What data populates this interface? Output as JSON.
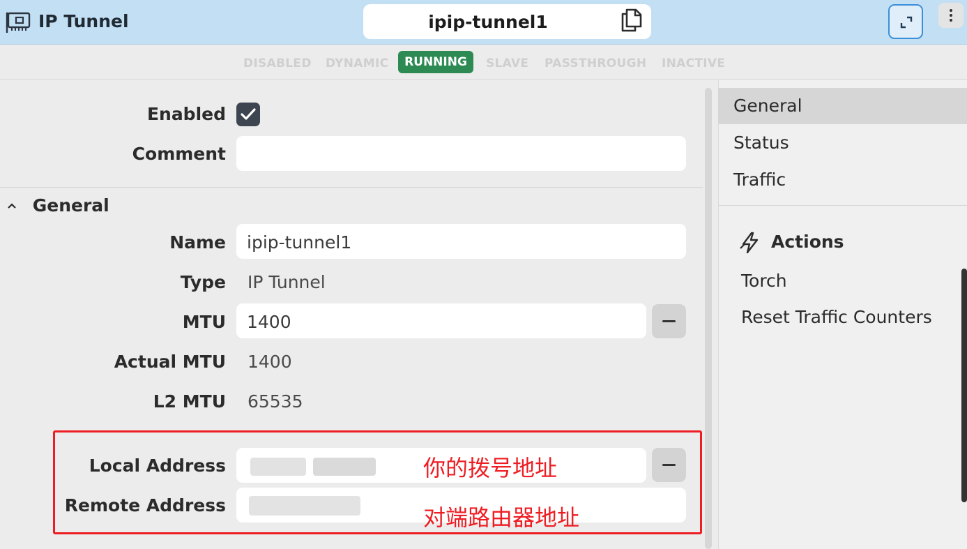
{
  "header": {
    "app_title": "IP Tunnel",
    "interface_name": "ipip-tunnel1",
    "icons": {
      "app": "network-card-icon",
      "copy": "copy-icon",
      "expand": "expand-icon",
      "menu": "kebab-menu-icon"
    }
  },
  "status_flags": [
    {
      "label": "DISABLED",
      "active": false
    },
    {
      "label": "DYNAMIC",
      "active": false
    },
    {
      "label": "RUNNING",
      "active": true
    },
    {
      "label": "SLAVE",
      "active": false
    },
    {
      "label": "PASSTHROUGH",
      "active": false
    },
    {
      "label": "INACTIVE",
      "active": false
    }
  ],
  "form": {
    "enabled": {
      "label": "Enabled",
      "checked": true
    },
    "comment": {
      "label": "Comment",
      "value": ""
    },
    "section_general": "General",
    "name": {
      "label": "Name",
      "value": "ipip-tunnel1"
    },
    "type": {
      "label": "Type",
      "value": "IP Tunnel"
    },
    "mtu": {
      "label": "MTU",
      "value": "1400"
    },
    "actual_mtu": {
      "label": "Actual MTU",
      "value": "1400"
    },
    "l2_mtu": {
      "label": "L2 MTU",
      "value": "65535"
    },
    "local_address": {
      "label": "Local Address",
      "value": ""
    },
    "remote_address": {
      "label": "Remote Address",
      "value": ""
    }
  },
  "annotations": {
    "local": "你的拨号地址",
    "remote": "对端路由器地址"
  },
  "sidebar": {
    "nav": [
      "General",
      "Status",
      "Traffic"
    ],
    "active_nav": "General",
    "actions_title": "Actions",
    "actions": [
      "Torch",
      "Reset Traffic Counters"
    ]
  },
  "colors": {
    "header_bg": "#c3dff4",
    "running_badge": "#2d8a53",
    "annotation_red": "#ee1d23"
  }
}
